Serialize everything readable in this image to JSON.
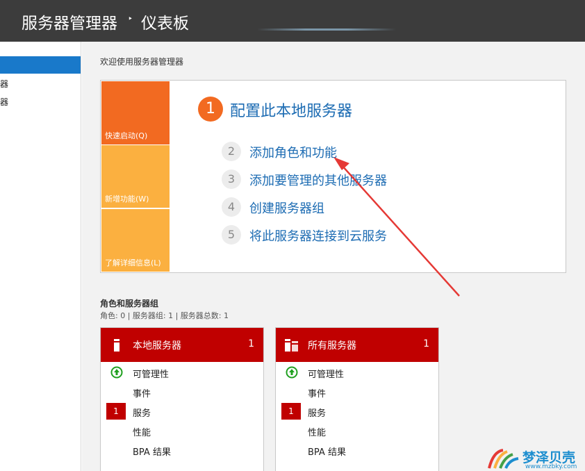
{
  "titlebar": {
    "app": "服务器管理器",
    "separator": "‣",
    "page": "仪表板"
  },
  "sidebar": {
    "items": [
      "器",
      "器"
    ]
  },
  "welcome": {
    "title": "欢迎使用服务器管理器",
    "tiles": [
      "快速启动(Q)",
      "新增功能(W)",
      "了解详细信息(L)"
    ],
    "steps": [
      {
        "num": "1",
        "label": "配置此本地服务器"
      },
      {
        "num": "2",
        "label": "添加角色和功能"
      },
      {
        "num": "3",
        "label": "添加要管理的其他服务器"
      },
      {
        "num": "4",
        "label": "创建服务器组"
      },
      {
        "num": "5",
        "label": "将此服务器连接到云服务"
      }
    ]
  },
  "roles": {
    "title": "角色和服务器组",
    "summary": "角色: 0 | 服务器组: 1 | 服务器总数: 1"
  },
  "cards": [
    {
      "title": "本地服务器",
      "count": "1",
      "rows": [
        "可管理性",
        "事件",
        "服务",
        "性能",
        "BPA 结果"
      ],
      "badge": "1"
    },
    {
      "title": "所有服务器",
      "count": "1",
      "rows": [
        "可管理性",
        "事件",
        "服务",
        "性能",
        "BPA 结果"
      ],
      "badge": "1"
    }
  ],
  "watermark": {
    "text": "梦泽贝壳",
    "url": "www.mzbky.com"
  },
  "colors": {
    "accent_orange": "#f26a21",
    "tile_yellow": "#fbb040",
    "card_red": "#c00000",
    "link_blue": "#1d6cb3",
    "select_blue": "#1979ca"
  }
}
